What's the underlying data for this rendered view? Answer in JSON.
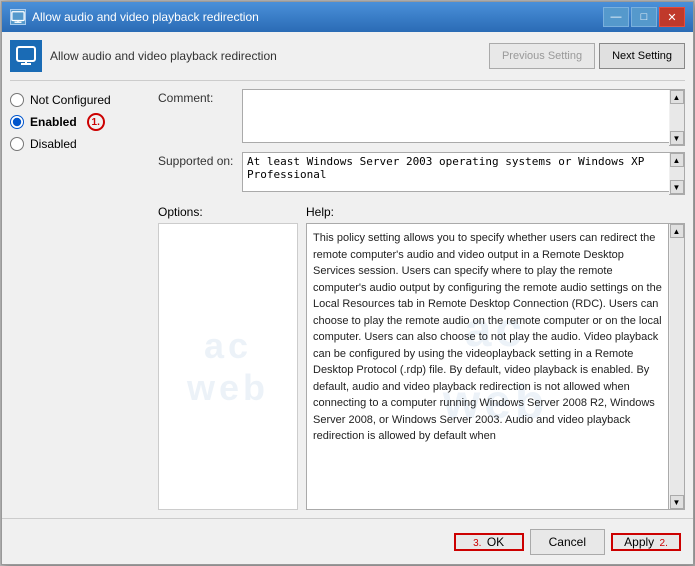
{
  "window": {
    "title": "Allow audio and video playback redirection",
    "icon_char": "🖥"
  },
  "title_controls": {
    "minimize": "—",
    "maximize": "□",
    "close": "✕"
  },
  "header": {
    "title": "Allow audio and video playback redirection",
    "prev_button": "Previous Setting",
    "next_button": "Next Setting"
  },
  "radio_options": [
    {
      "id": "not-configured",
      "label": "Not Configured",
      "checked": false
    },
    {
      "id": "enabled",
      "label": "Enabled",
      "checked": true
    },
    {
      "id": "disabled",
      "label": "Disabled",
      "checked": false
    }
  ],
  "step_badges": {
    "enabled_badge": "1.",
    "apply_badge": "2.",
    "ok_badge": "3."
  },
  "fields": {
    "comment_label": "Comment:",
    "comment_value": "",
    "supported_label": "Supported on:",
    "supported_value": "At least Windows Server 2003 operating systems or Windows XP Professional"
  },
  "panels": {
    "options_label": "Options:",
    "help_label": "Help:"
  },
  "help_text": "This policy setting allows you to specify whether users can redirect the remote computer's audio and video output in a Remote Desktop Services session.\nUsers can specify where to play the remote computer's audio output by configuring the remote audio settings on the Local Resources tab in Remote Desktop Connection (RDC). Users can choose to play the remote audio on the remote computer or on the local computer. Users can also choose to not play the audio. Video playback can be configured by using the videoplayback setting in a Remote Desktop Protocol (.rdp) file. By default, video playback is enabled.\n\nBy default, audio and video playback redirection is not allowed when connecting to a computer running Windows Server 2008 R2, Windows Server 2008, or Windows Server 2003. Audio and video playback redirection is allowed by default when",
  "footer": {
    "ok_label": "OK",
    "cancel_label": "Cancel",
    "apply_label": "Apply"
  },
  "watermark": "ac\nweb"
}
